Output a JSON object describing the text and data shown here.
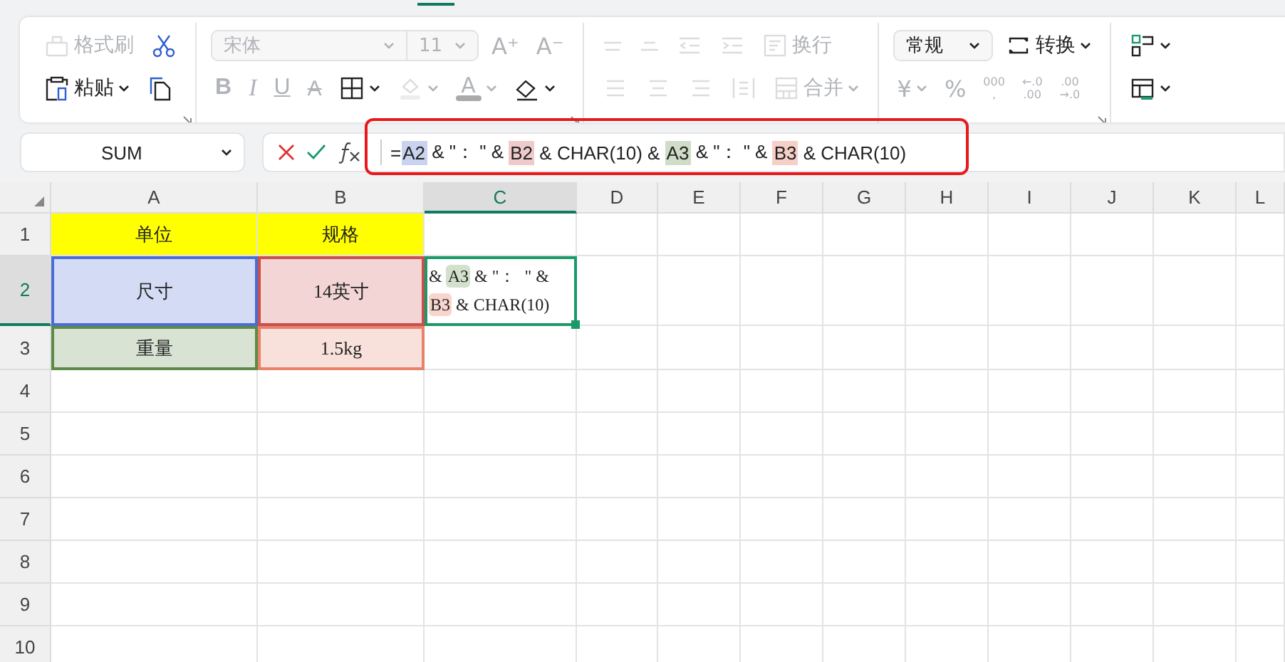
{
  "ribbon": {
    "groups": [
      {
        "upper": [
          {
            "kind": "format-painter",
            "label": "格式刷",
            "disabled": true
          },
          {
            "kind": "cut",
            "disabled": false
          }
        ],
        "lower": [
          {
            "kind": "paste",
            "label": "粘贴",
            "disabled": false,
            "dropdown": true
          },
          {
            "kind": "copy",
            "disabled": false
          }
        ],
        "launcher": true
      },
      {
        "upper": [
          {
            "kind": "font-select",
            "label": "宋体",
            "disabled": true
          },
          {
            "kind": "size-select",
            "label": "11",
            "disabled": true
          },
          {
            "kind": "glyph",
            "label": "A⁺",
            "disabled": true
          },
          {
            "kind": "glyph",
            "label": "A⁻",
            "disabled": true
          }
        ],
        "lower": [
          {
            "kind": "bold",
            "label": "B",
            "disabled": true
          },
          {
            "kind": "italic",
            "label": "I",
            "disabled": true
          },
          {
            "kind": "underline",
            "label": "U",
            "disabled": true
          },
          {
            "kind": "strike",
            "label": "A",
            "disabled": true
          },
          {
            "kind": "borders",
            "disabled": false,
            "dropdown": true
          },
          {
            "kind": "fill",
            "disabled": true,
            "dropdown": true
          },
          {
            "kind": "font-color",
            "label": "A",
            "disabled": true,
            "dropdown": true
          },
          {
            "kind": "clear",
            "disabled": false,
            "dropdown": true
          }
        ],
        "launcher": true
      },
      {
        "upper": [
          {
            "kind": "align-top",
            "disabled": true
          },
          {
            "kind": "align-middle",
            "disabled": true
          },
          {
            "kind": "indent-less",
            "disabled": true
          },
          {
            "kind": "indent-more",
            "disabled": true
          },
          {
            "kind": "wrap",
            "label": "换行",
            "disabled": true
          }
        ],
        "lower": [
          {
            "kind": "align-left",
            "disabled": true
          },
          {
            "kind": "align-center",
            "disabled": true
          },
          {
            "kind": "align-right",
            "disabled": true
          },
          {
            "kind": "distribute",
            "disabled": true
          },
          {
            "kind": "merge",
            "label": "合并",
            "disabled": true,
            "dropdown": true
          }
        ]
      },
      {
        "upper": [
          {
            "kind": "format-select",
            "label": "常规",
            "disabled": false
          },
          {
            "kind": "convert",
            "label": "转换",
            "disabled": false,
            "dropdown": true
          }
        ],
        "lower": [
          {
            "kind": "glyph",
            "label": "¥",
            "disabled": true,
            "dropdown": true
          },
          {
            "kind": "glyph",
            "label": "%",
            "disabled": true
          },
          {
            "kind": "stack",
            "lines": [
              "000",
              ","
            ],
            "disabled": true
          },
          {
            "kind": "stack",
            "lines": [
              "←.0",
              ".00"
            ],
            "disabled": true
          },
          {
            "kind": "stack",
            "lines": [
              ".00",
              "→.0"
            ],
            "disabled": true
          }
        ],
        "launcher": true
      },
      {
        "upper": [
          {
            "kind": "cond-format",
            "disabled": false,
            "dropdown": true
          }
        ],
        "lower": [
          {
            "kind": "table-style",
            "disabled": false,
            "dropdown": true
          }
        ]
      }
    ]
  },
  "formula_bar": {
    "name_box": "SUM",
    "formula": [
      {
        "text": "="
      },
      {
        "text": "A2",
        "color": "#c9d3ef"
      },
      {
        "text": " & \"： \" & "
      },
      {
        "text": "B2",
        "color": "#efcaca"
      },
      {
        "text": " & CHAR(10) & "
      },
      {
        "text": "A3",
        "color": "#cfdcc8"
      },
      {
        "text": " & \"： \" & "
      },
      {
        "text": "B3",
        "color": "#f6cfc6"
      },
      {
        "text": " & CHAR(10)"
      }
    ]
  },
  "sheet": {
    "columns": [
      {
        "label": "A",
        "selected": false
      },
      {
        "label": "B",
        "selected": false
      },
      {
        "label": "C",
        "selected": true
      },
      {
        "label": "D",
        "selected": false
      },
      {
        "label": "E",
        "selected": false
      },
      {
        "label": "F",
        "selected": false
      },
      {
        "label": "G",
        "selected": false
      },
      {
        "label": "H",
        "selected": false
      },
      {
        "label": "I",
        "selected": false
      },
      {
        "label": "J",
        "selected": false
      },
      {
        "label": "K",
        "selected": false
      },
      {
        "label": "L",
        "selected": false
      }
    ],
    "rows": [
      {
        "label": "1",
        "selected": false,
        "cells": [
          {
            "kind": "plain",
            "text": "单位",
            "color": "#ffff00"
          },
          {
            "kind": "plain",
            "text": "规格",
            "color": "#ffff00"
          }
        ]
      },
      {
        "label": "2",
        "selected": true,
        "cells": [
          {
            "kind": "ref",
            "text": "尺寸",
            "color": "#4a6cd4"
          },
          {
            "kind": "ref",
            "text": "14英寸",
            "color": "#c9504c"
          },
          {
            "kind": "editor",
            "lines": [
              [
                {
                  "text": "& "
                },
                {
                  "text": "A3",
                  "color": "#d3e0cc"
                },
                {
                  "text": " & \"：  \" &"
                }
              ],
              [
                {
                  "text": "B3",
                  "color": "#f8d5cd"
                },
                {
                  "text": " & CHAR(10)"
                }
              ]
            ]
          }
        ]
      },
      {
        "label": "3",
        "selected": false,
        "cells": [
          {
            "kind": "ref",
            "text": "重量",
            "color": "#5d8a46"
          },
          {
            "kind": "ref",
            "text": "1.5kg",
            "color": "#e8826a"
          }
        ]
      },
      {
        "label": "4",
        "selected": false,
        "cells": []
      },
      {
        "label": "5",
        "selected": false,
        "cells": []
      },
      {
        "label": "6",
        "selected": false,
        "cells": []
      },
      {
        "label": "7",
        "selected": false,
        "cells": []
      },
      {
        "label": "8",
        "selected": false,
        "cells": []
      },
      {
        "label": "9",
        "selected": false,
        "cells": []
      },
      {
        "label": "10",
        "selected": false,
        "cells": []
      }
    ]
  }
}
